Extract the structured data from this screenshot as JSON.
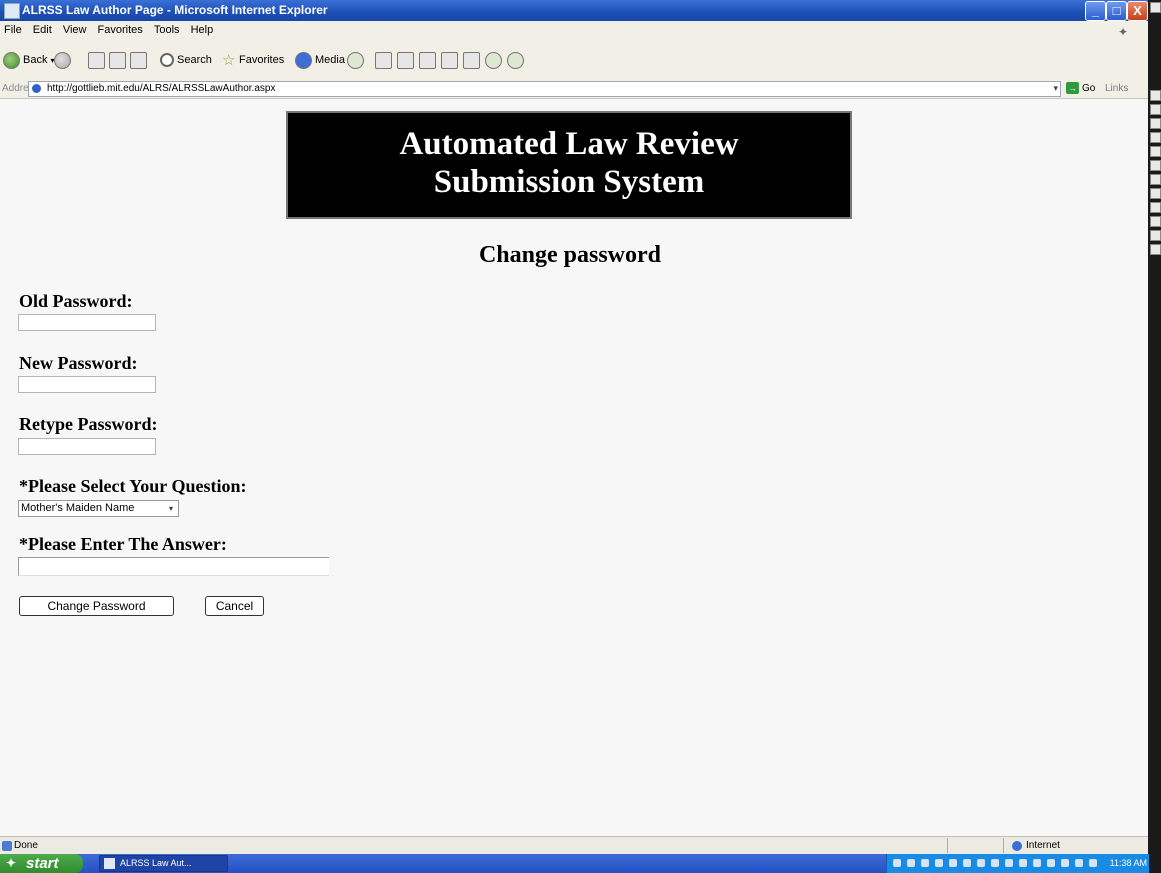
{
  "window": {
    "title": "ALRSS Law Author Page - Microsoft Internet Explorer",
    "controls": {
      "minimize": "_",
      "maximize": "□",
      "close": "X"
    }
  },
  "menu": [
    "File",
    "Edit",
    "View",
    "Favorites",
    "Tools",
    "Help"
  ],
  "toolbar": {
    "back_label": "Back",
    "search_label": "Search",
    "favorites_label": "Favorites",
    "media_label": "Media"
  },
  "address": {
    "label": "Address",
    "url": "http://gottlieb.mit.edu/ALRS/ALRSSLawAuthor.aspx",
    "go_label": "Go",
    "links_label": "Links"
  },
  "page": {
    "banner_line1": "Automated Law Review",
    "banner_line2": "Submission System",
    "heading": "Change password",
    "fields": {
      "old_password_label": "Old Password:",
      "new_password_label": "New Password:",
      "retype_password_label": "Retype Password:",
      "question_label": "*Please Select Your Question:",
      "question_selected": "Mother's Maiden Name",
      "answer_label": "*Please Enter The Answer:"
    },
    "buttons": {
      "change_password": "Change Password",
      "cancel": "Cancel"
    }
  },
  "statusbar": {
    "status_text": "Done",
    "zone": "Internet"
  },
  "taskbar": {
    "start_label": "start",
    "task_label": "ALRSS Law Aut...",
    "clock": "11:38 AM"
  },
  "icons": [
    "ie-page-icon",
    "back-arrow-icon",
    "forward-arrow-icon",
    "stop-icon",
    "refresh-icon",
    "home-icon",
    "search-icon",
    "favorites-star-icon",
    "media-icon",
    "history-icon",
    "mail-icon",
    "print-icon",
    "edit-icon",
    "discuss-icon",
    "messenger-icon",
    "go-arrow-icon",
    "windows-flag-icon",
    "internet-zone-icon",
    "dropdown-arrow-icon"
  ],
  "colors": {
    "titlebar": "#1c4fb5",
    "banner_bg": "#000000",
    "banner_text": "#ffffff",
    "start_button": "#2f8c2c",
    "taskbar": "#2550c2"
  }
}
